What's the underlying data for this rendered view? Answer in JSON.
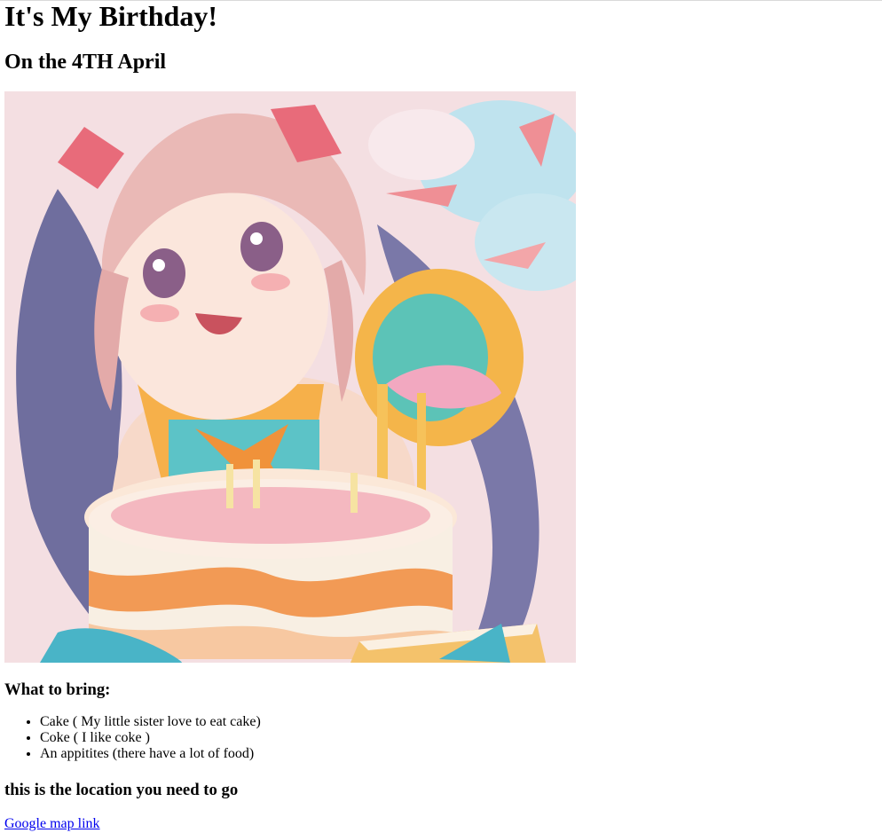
{
  "page": {
    "title": "It's My Birthday!",
    "subtitle": "On the 4TH April"
  },
  "hero_image": {
    "description_icon": "birthday-girl-with-cake-illustration",
    "palette": {
      "background": "#f3d9dd",
      "sky": "#bfe3ee",
      "hair": "#e9b9b5",
      "hair_shadow": "#6f6e9e",
      "ribbon": "#e86b7a",
      "cake_frosting": "#f8efe3",
      "cake_stripe": "#f29a55",
      "gift": "#5cc3c7",
      "bow": "#f0923a",
      "drink_cup": "#f4b54a"
    }
  },
  "bring": {
    "heading": "What to bring:",
    "items": [
      "Cake ( My little sister love to eat cake)",
      "Coke ( I like coke )",
      "An appitites (there have a lot of food)"
    ]
  },
  "location": {
    "heading": "this is the location you need to go",
    "link_label": "Google map link"
  }
}
